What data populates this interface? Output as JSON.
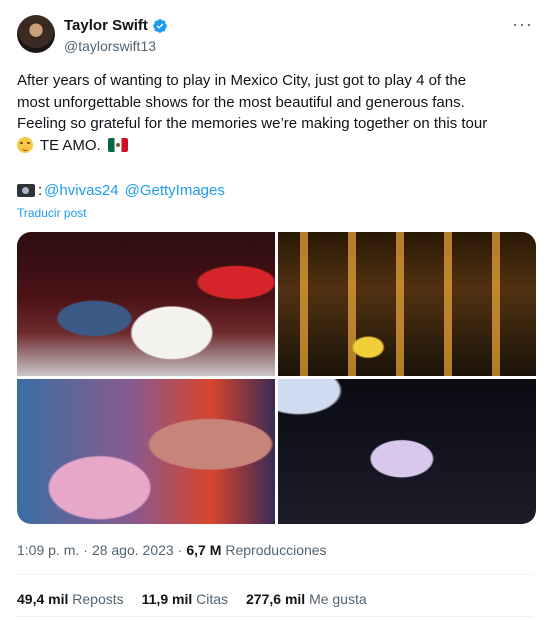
{
  "author": {
    "display_name": "Taylor Swift",
    "handle": "@taylorswift13",
    "avatar_icon": "user-avatar",
    "verified_icon": "verified-badge-icon",
    "verified_color": "#1d9bf0"
  },
  "more_label": "···",
  "tweet": {
    "lines": [
      "After years of wanting to play in Mexico City, just got to play 4 of the",
      "most unforgettable shows for the most beautiful and generous fans.",
      "Feeling so grateful for the memories we’re making together on this tour"
    ],
    "last_line_text": "TE AMO.",
    "emoji_icons": [
      "smiling-face-with-tear-emoji",
      "mexico-flag-emoji"
    ],
    "credits_prefix": ":",
    "credit_mentions": [
      "@hvivas24",
      "@GettyImages"
    ],
    "camera_icon": "camera-emoji"
  },
  "translate_label": "Traducir post",
  "media": {
    "photos": [
      "photo-1",
      "photo-2",
      "photo-3",
      "photo-4"
    ]
  },
  "meta": {
    "time": "1:09 p. m.",
    "separator": "·",
    "date": "28 ago. 2023",
    "views_count": "6,7 M",
    "views_label": "Reproducciones"
  },
  "stats": {
    "reposts_count": "49,4 mil",
    "reposts_label": "Reposts",
    "quotes_count": "11,9 mil",
    "quotes_label": "Citas",
    "likes_count": "277,6 mil",
    "likes_label": "Me gusta"
  },
  "colors": {
    "link": "#1d9bf0",
    "secondary_text": "#536471",
    "primary_text": "#0f1419"
  }
}
